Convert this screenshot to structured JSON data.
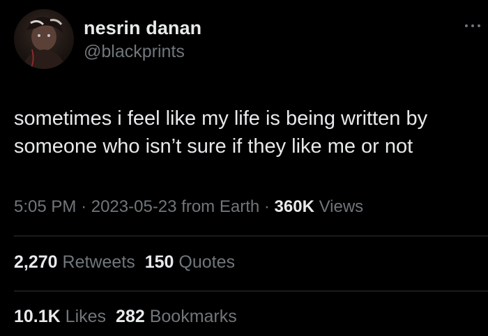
{
  "author": {
    "display_name": "nesrin danan",
    "handle": "@blackprints"
  },
  "icons": {
    "more": "more-options-icon",
    "avatar": "profile-avatar"
  },
  "tweet": {
    "text_line_1": "sometimes i feel like my life is being written by",
    "text_line_2": "someone who isn’t sure if they like me or not"
  },
  "meta": {
    "time": "5:05 PM",
    "separator": "·",
    "date": "2023-05-23",
    "source": "from Earth",
    "views_count": "360K",
    "views_label": "Views"
  },
  "engagement": {
    "retweets_count": "2,270",
    "retweets_label": "Retweets",
    "quotes_count": "150",
    "quotes_label": "Quotes",
    "likes_count": "10.1K",
    "likes_label": "Likes",
    "bookmarks_count": "282",
    "bookmarks_label": "Bookmarks"
  },
  "colors": {
    "background": "#000000",
    "primary_text": "#e7e9ea",
    "secondary_text": "#71767b",
    "divider": "#2f3336"
  }
}
